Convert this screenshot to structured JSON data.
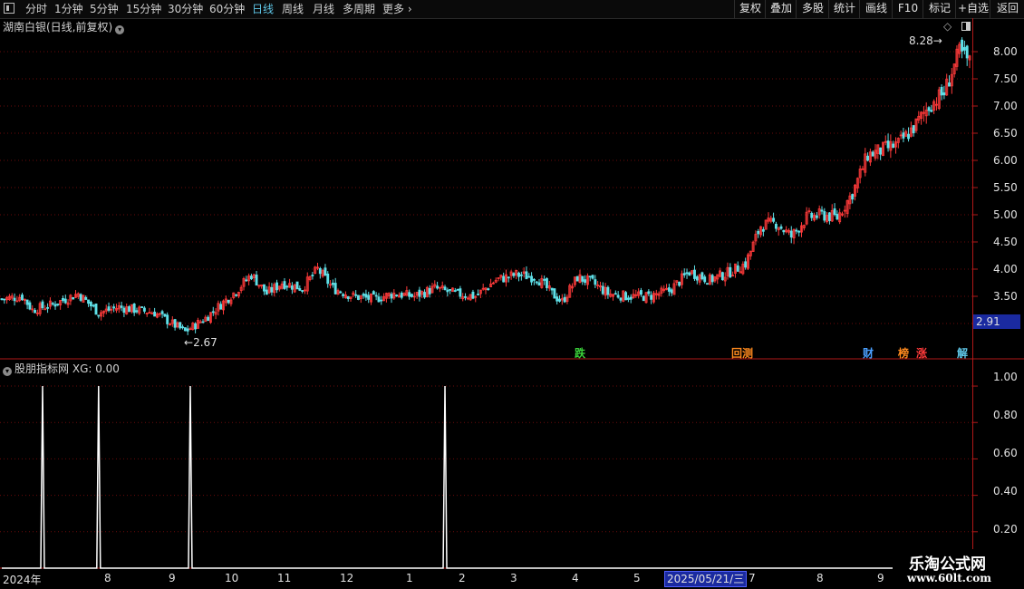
{
  "toolbar": {
    "periods": [
      "分时",
      "1分钟",
      "5分钟",
      "15分钟",
      "30分钟",
      "60分钟",
      "日线",
      "周线",
      "月线",
      "多周期",
      "更多"
    ],
    "active_period": "日线",
    "right_buttons": [
      "复权",
      "叠加",
      "多股",
      "统计",
      "画线",
      "F10",
      "标记",
      "+自选",
      "返回"
    ]
  },
  "main_panel": {
    "title": "湖南白银(日线,前复权)",
    "high_annotation": "8.28",
    "low_annotation": "2.67",
    "current_price_tag": "2.91",
    "y_labels": [
      "8.00",
      "7.50",
      "7.00",
      "6.50",
      "6.00",
      "5.50",
      "5.00",
      "4.50",
      "4.00",
      "3.50"
    ],
    "signals": [
      {
        "text": "跌",
        "color": "#3ad13a"
      },
      {
        "text": "回",
        "color": "#ff8a1e"
      },
      {
        "text": "测",
        "color": "#ff8a1e"
      },
      {
        "text": "财",
        "color": "#4aa0ff"
      },
      {
        "text": "榜",
        "color": "#ff8a1e"
      },
      {
        "text": "涨",
        "color": "#ff3a3a"
      },
      {
        "text": "解",
        "color": "#5fc7e8"
      }
    ]
  },
  "sub_panel": {
    "title": "股朋指标网",
    "indicator_value": "XG: 0.00",
    "y_labels": [
      "1.00",
      "0.80",
      "0.60",
      "0.40",
      "0.20"
    ]
  },
  "x_axis": {
    "labels": [
      "2024年",
      "8",
      "9",
      "10",
      "11",
      "12",
      "1",
      "2",
      "3",
      "4",
      "5",
      "7",
      "8",
      "9"
    ],
    "cursor_date": "2025/05/21/三"
  },
  "watermark": {
    "line1": "乐淘公式网",
    "line2": "www.60lt.com"
  },
  "colors": {
    "up": "#ff3a3a",
    "down": "#5fe0e8",
    "axis": "#b01818",
    "grid": "#6a0a0a",
    "price_tag": "#1a2aa0"
  },
  "chart_data": {
    "type": "candlestick",
    "title": "湖南白银(日线,前复权)",
    "ylim": [
      2.9,
      8.6
    ],
    "y_ticks": [
      3.5,
      4.0,
      4.5,
      5.0,
      5.5,
      6.0,
      6.5,
      7.0,
      7.5,
      8.0
    ],
    "x_ticks": [
      "2024年",
      "8",
      "9",
      "10",
      "11",
      "12",
      "1",
      "2",
      "3",
      "4",
      "5",
      "7",
      "8",
      "9"
    ],
    "close_path_points": [
      {
        "i": 0,
        "v": 3.45
      },
      {
        "i": 8,
        "v": 3.5
      },
      {
        "i": 12,
        "v": 3.25
      },
      {
        "i": 20,
        "v": 3.35
      },
      {
        "i": 30,
        "v": 3.55
      },
      {
        "i": 38,
        "v": 3.2
      },
      {
        "i": 46,
        "v": 3.3
      },
      {
        "i": 60,
        "v": 3.2
      },
      {
        "i": 72,
        "v": 2.85
      },
      {
        "i": 80,
        "v": 3.1
      },
      {
        "i": 86,
        "v": 3.35
      },
      {
        "i": 92,
        "v": 3.6
      },
      {
        "i": 98,
        "v": 3.9
      },
      {
        "i": 104,
        "v": 3.55
      },
      {
        "i": 110,
        "v": 3.75
      },
      {
        "i": 118,
        "v": 3.65
      },
      {
        "i": 124,
        "v": 4.0
      },
      {
        "i": 130,
        "v": 3.65
      },
      {
        "i": 138,
        "v": 3.5
      },
      {
        "i": 146,
        "v": 3.45
      },
      {
        "i": 154,
        "v": 3.55
      },
      {
        "i": 162,
        "v": 3.5
      },
      {
        "i": 170,
        "v": 3.65
      },
      {
        "i": 178,
        "v": 3.55
      },
      {
        "i": 186,
        "v": 3.5
      },
      {
        "i": 194,
        "v": 3.8
      },
      {
        "i": 202,
        "v": 3.9
      },
      {
        "i": 210,
        "v": 3.85
      },
      {
        "i": 216,
        "v": 3.55
      },
      {
        "i": 220,
        "v": 3.4
      },
      {
        "i": 226,
        "v": 3.85
      },
      {
        "i": 232,
        "v": 3.75
      },
      {
        "i": 238,
        "v": 3.55
      },
      {
        "i": 246,
        "v": 3.5
      },
      {
        "i": 254,
        "v": 3.5
      },
      {
        "i": 262,
        "v": 3.6
      },
      {
        "i": 270,
        "v": 3.95
      },
      {
        "i": 278,
        "v": 3.8
      },
      {
        "i": 286,
        "v": 3.95
      },
      {
        "i": 292,
        "v": 4.1
      },
      {
        "i": 298,
        "v": 4.8
      },
      {
        "i": 304,
        "v": 4.85
      },
      {
        "i": 310,
        "v": 4.6
      },
      {
        "i": 316,
        "v": 4.95
      },
      {
        "i": 322,
        "v": 5.0
      },
      {
        "i": 328,
        "v": 4.95
      },
      {
        "i": 334,
        "v": 5.4
      },
      {
        "i": 340,
        "v": 6.1
      },
      {
        "i": 346,
        "v": 6.2
      },
      {
        "i": 352,
        "v": 6.3
      },
      {
        "i": 358,
        "v": 6.6
      },
      {
        "i": 364,
        "v": 7.0
      },
      {
        "i": 370,
        "v": 7.25
      },
      {
        "i": 376,
        "v": 8.0
      },
      {
        "i": 380,
        "v": 7.8
      }
    ],
    "candle_count": 381,
    "marked_high": 8.28,
    "marked_low": 2.67,
    "indicator": {
      "name": "XG",
      "ylim": [
        0,
        1.05
      ],
      "spikes_at_candle": [
        16,
        38,
        74,
        174
      ],
      "spike_value": 1.0,
      "baseline": 0.0
    }
  }
}
